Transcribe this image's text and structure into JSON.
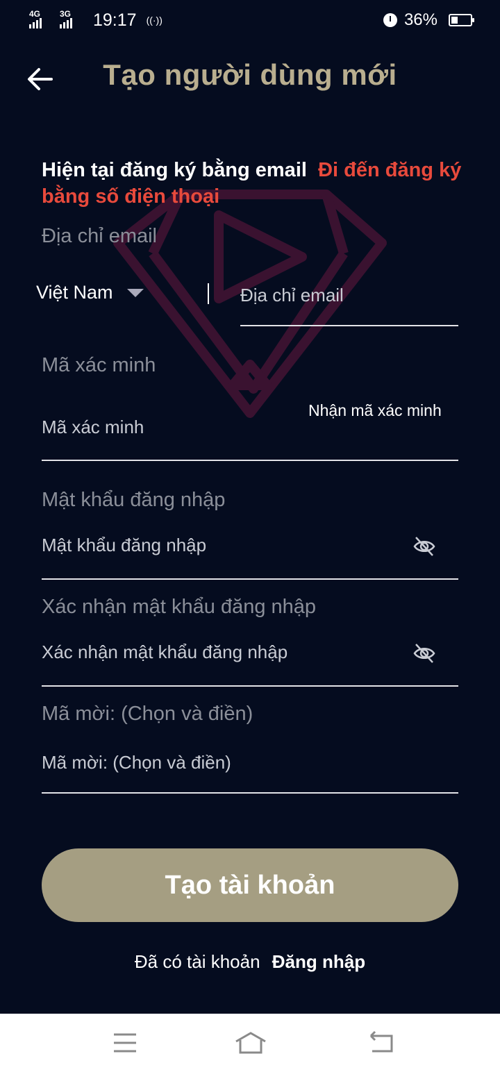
{
  "status_bar": {
    "network_1": "4G",
    "network_2": "3G",
    "time": "19:17",
    "battery_percent": "36%",
    "battery_level": 0.36
  },
  "header": {
    "title": "Tạo người  dùng mới",
    "back_icon": "arrow-left-icon"
  },
  "register_mode": {
    "current": "Hiện tại đăng ký bằng email",
    "switch_link": "Đi đến đăng ký bằng số điện thoại"
  },
  "form": {
    "email": {
      "title": "Địa chỉ email",
      "country": "Việt Nam",
      "placeholder": "Địa chỉ email"
    },
    "code": {
      "title": "Mã xác minh",
      "placeholder": "Mã xác minh",
      "get_code": "Nhận mã xác minh"
    },
    "password": {
      "title": "Mật khẩu đăng nhập",
      "placeholder": "Mật khẩu đăng nhập"
    },
    "confirm_password": {
      "title": "Xác nhận mật khẩu đăng nhập",
      "placeholder": "Xác nhận mật khẩu đăng nhập"
    },
    "invite": {
      "title": "Mã mời: (Chọn và điền)",
      "placeholder": "Mã mời: (Chọn và điền)"
    }
  },
  "actions": {
    "create_account": "Tạo tài khoản",
    "have_account": "Đã có tài khoản",
    "login": "Đăng nhập"
  },
  "colors": {
    "background": "#050c1f",
    "title": "#b9ae8f",
    "link_red": "#e84a3c",
    "button": "#a59e82",
    "watermark": "#3a1230"
  }
}
